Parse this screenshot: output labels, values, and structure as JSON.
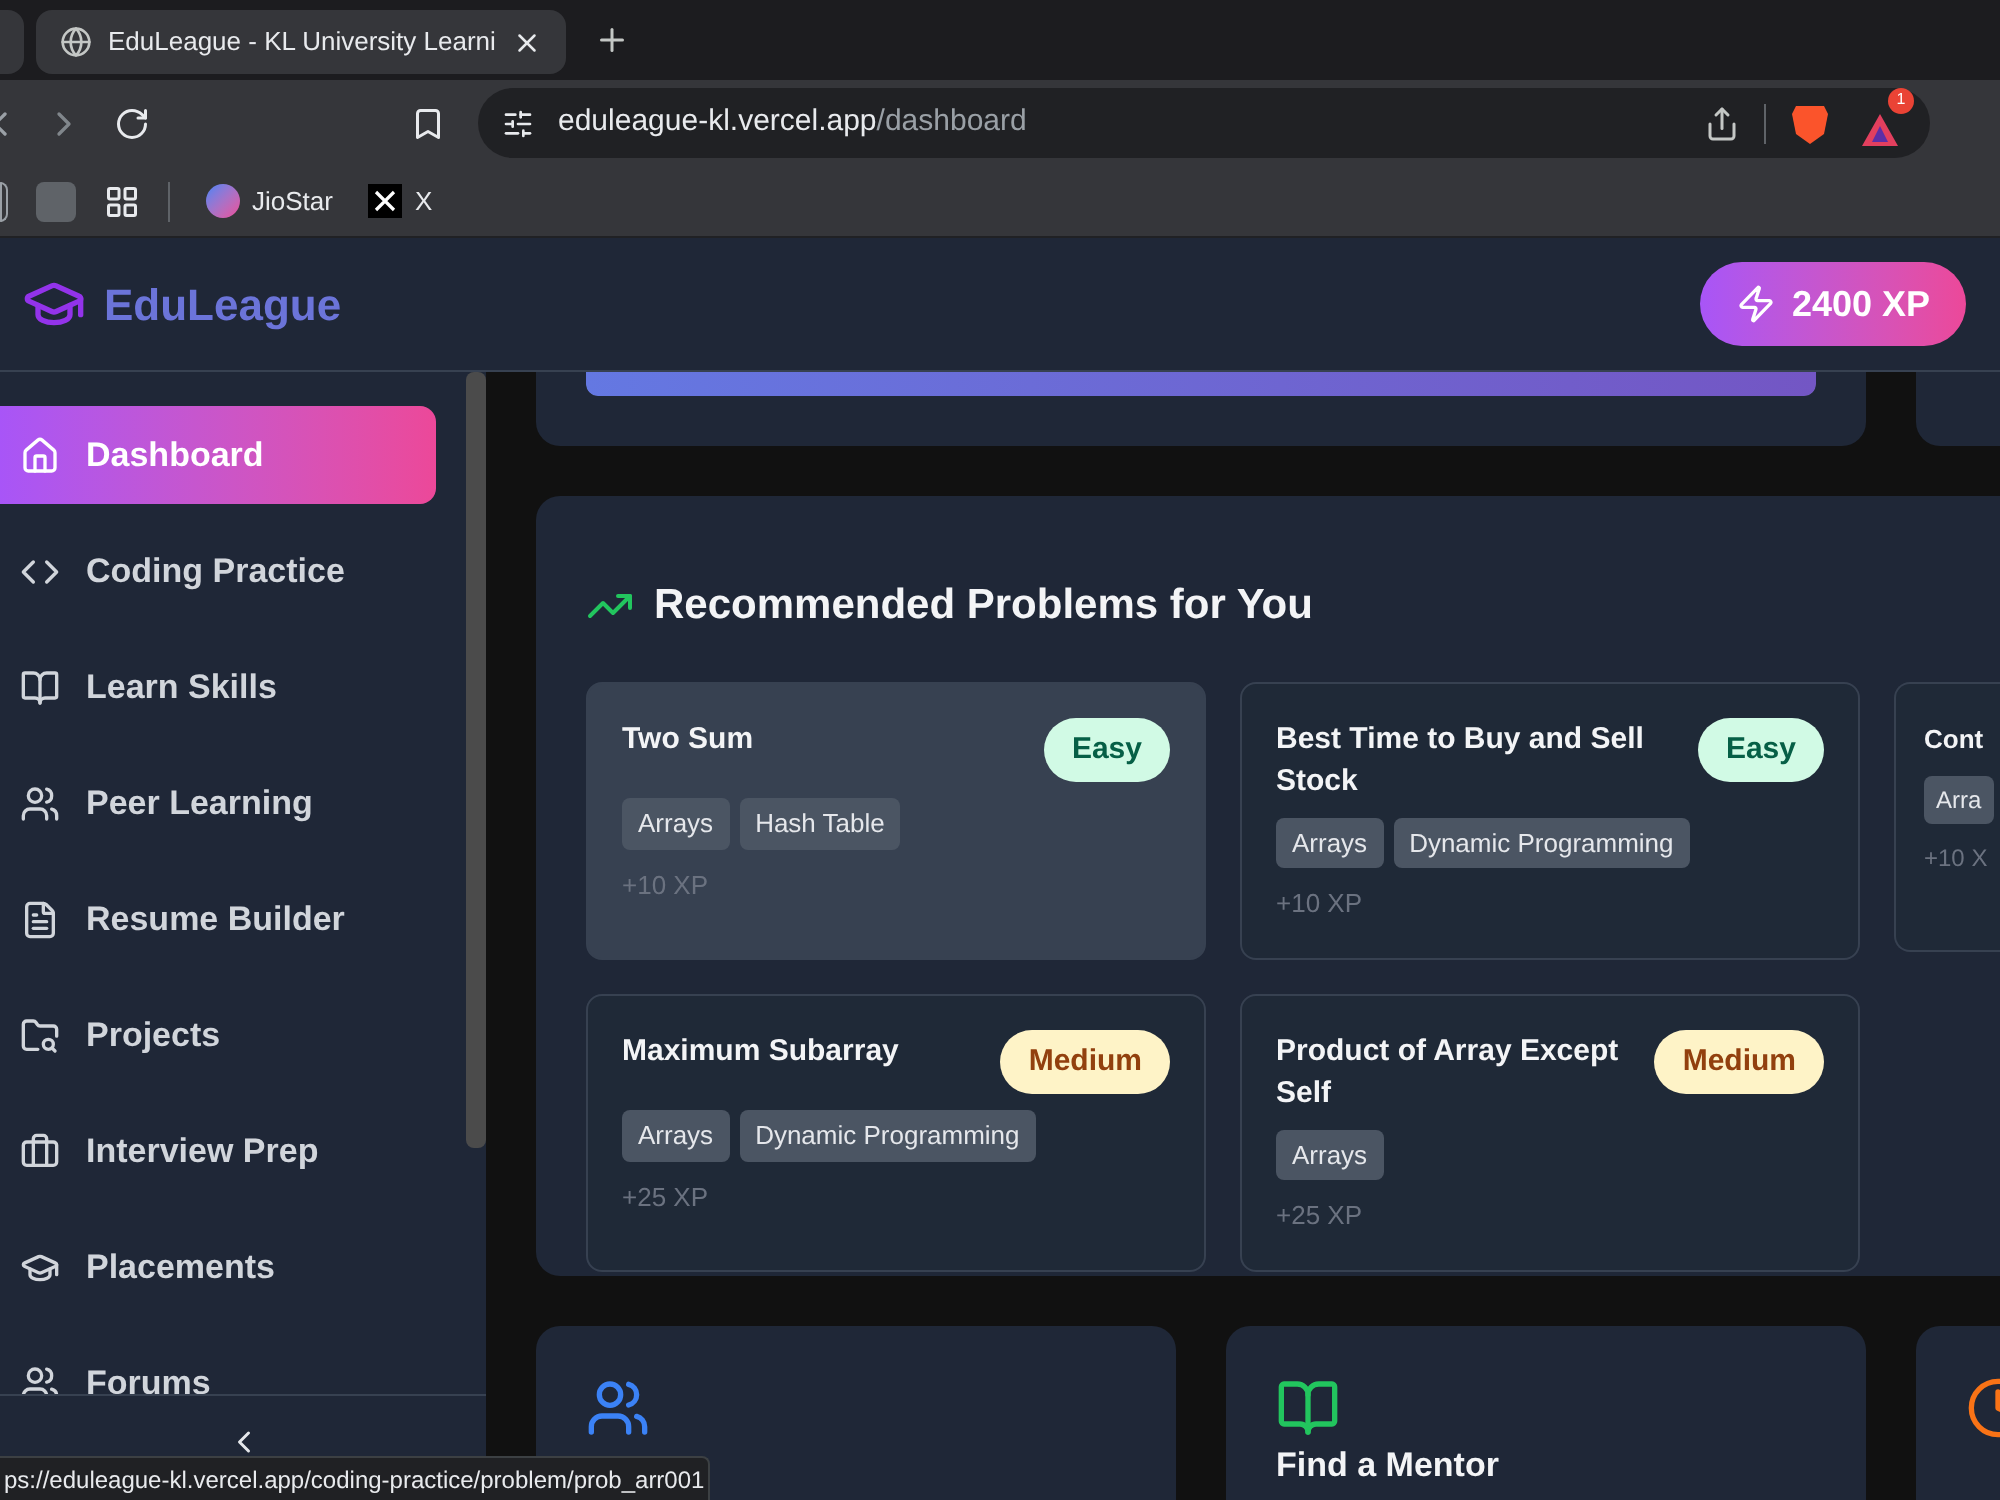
{
  "browser": {
    "tabs": [
      {
        "title": "EduLeague - KL University Learni",
        "selected": true
      }
    ],
    "url_host": "eduleague-kl.vercel.app",
    "url_path": "/dashboard",
    "extension_badge": "1",
    "bookmarks": [
      {
        "label": "JioStar",
        "kind": "star"
      },
      {
        "label": "X",
        "kind": "x"
      }
    ],
    "status_url": "ps://eduleague-kl.vercel.app/coding-practice/problem/prob_arr001"
  },
  "header": {
    "brand": "EduLeague",
    "xp": "2400 XP"
  },
  "sidebar": {
    "items": [
      {
        "label": "Dashboard",
        "selected": true
      },
      {
        "label": "Coding Practice",
        "selected": false
      },
      {
        "label": "Learn Skills",
        "selected": false
      },
      {
        "label": "Peer Learning",
        "selected": false
      },
      {
        "label": "Resume Builder",
        "selected": false
      },
      {
        "label": "Projects",
        "selected": false
      },
      {
        "label": "Interview Prep",
        "selected": false
      },
      {
        "label": "Placements",
        "selected": false
      },
      {
        "label": "Forums",
        "selected": false
      }
    ]
  },
  "recommended": {
    "title": "Recommended Problems for You",
    "problems": [
      {
        "title": "Two Sum",
        "difficulty": "Easy",
        "kind": "easy",
        "tags": [
          "Arrays",
          "Hash Table"
        ],
        "xp": "+10 XP",
        "highlighted": true
      },
      {
        "title": "Best Time to Buy and Sell Stock",
        "difficulty": "Easy",
        "kind": "easy",
        "tags": [
          "Arrays",
          "Dynamic Programming"
        ],
        "xp": "+10 XP",
        "highlighted": false
      },
      {
        "title": "Cont",
        "tags": [
          "Arra"
        ],
        "xp": "+10 X",
        "highlighted": false
      },
      {
        "title": "Maximum Subarray",
        "difficulty": "Medium",
        "kind": "medium",
        "tags": [
          "Arrays",
          "Dynamic Programming"
        ],
        "xp": "+25 XP",
        "highlighted": false
      },
      {
        "title": "Product of Array Except Self",
        "difficulty": "Medium",
        "kind": "medium",
        "tags": [
          "Arrays"
        ],
        "xp": "+25 XP",
        "highlighted": false
      }
    ]
  },
  "progress": {
    "level": 1
  },
  "mentor_card": {
    "title": "Find a Mentor"
  }
}
